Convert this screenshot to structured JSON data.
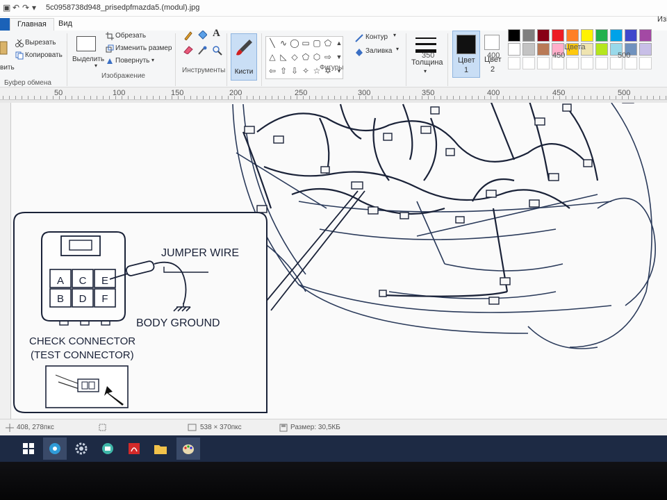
{
  "titlebar": {
    "title": "5c0958738d948_prisedpfmazda5.(modul).jpg"
  },
  "tabs": {
    "file": "",
    "home": "Главная",
    "view": "Вид"
  },
  "ribbon": {
    "clipboard": {
      "paste": "вить",
      "cut": "Вырезать",
      "copy": "Копировать",
      "label": "Буфер обмена"
    },
    "image": {
      "select": "Выделить",
      "crop": "Обрезать",
      "resize": "Изменить размер",
      "rotate": "Повернуть",
      "label": "Изображение"
    },
    "tools": {
      "label": "Инструменты"
    },
    "brushes": {
      "label": "Кисти"
    },
    "shapes": {
      "outline": "Контур",
      "fill": "Заливка",
      "label": "Фигуры"
    },
    "size": {
      "label": "Толщина"
    },
    "color1": {
      "label_a": "Цвет",
      "label_b": "1"
    },
    "color2": {
      "label_a": "Цвет",
      "label_b": "2"
    },
    "colors": {
      "label": "Цвета",
      "edit": "Изм"
    },
    "palette": [
      "#000000",
      "#7f7f7f",
      "#880015",
      "#ed1c24",
      "#ff7f27",
      "#fff200",
      "#22b14c",
      "#00a2e8",
      "#3f48cc",
      "#a349a4",
      "#ffffff",
      "#c3c3c3",
      "#b97a57",
      "#ffaec9",
      "#ffc90e",
      "#efe4b0",
      "#b5e61d",
      "#99d9ea",
      "#7092be",
      "#c8bfe7"
    ]
  },
  "ruler": {
    "top": [
      "350",
      "400",
      "450",
      "500"
    ],
    "bottom": [
      "50",
      "100",
      "150",
      "200",
      "250",
      "300",
      "350",
      "400",
      "450",
      "500"
    ]
  },
  "diagram": {
    "jumper": "JUMPER WIRE",
    "ground": "BODY GROUND",
    "check1": "CHECK CONNECTOR",
    "check2": "(TEST CONNECTOR)",
    "pins": [
      "A",
      "C",
      "E",
      "B",
      "D",
      "F"
    ]
  },
  "statusbar": {
    "cursor": "408, 278пкс",
    "dimensions": "538 × 370пкс",
    "size": "Размер: 30,5КБ"
  },
  "taskbar": {
    "apps": [
      "start-icon",
      "browser-icon",
      "settings-icon",
      "app-icon",
      "pdf-icon",
      "folder-icon",
      "paint-icon"
    ]
  }
}
